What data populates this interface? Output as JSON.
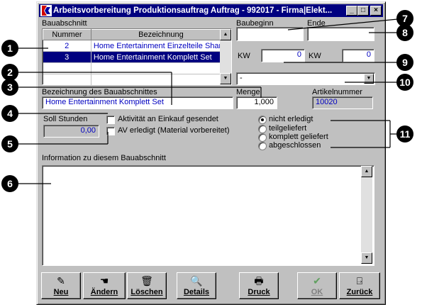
{
  "window": {
    "title": "Arbeitsvorbereitung Produktionsauftrag  Auftrag - 992017 - Firma|Elekt...",
    "controls": {
      "minimize": "_",
      "maximize": "□",
      "close": "×"
    }
  },
  "bauabschnitt": {
    "section_label": "Bauabschnitt",
    "columns": [
      "Nummer",
      "Bezeichnung"
    ],
    "rows": [
      {
        "nummer": "2",
        "bezeichnung": "Home Entertainment Einzelteile Sharp"
      },
      {
        "nummer": "3",
        "bezeichnung": "Home Entertainment Komplett Set"
      }
    ],
    "selected_row": 1
  },
  "schedule": {
    "baubeginn_label": "Baubeginn",
    "baubeginn_value": "",
    "ende_label": "Ende",
    "ende_value": "",
    "kw_label_1": "KW",
    "kw_value_1": "0",
    "kw_label_2": "KW",
    "kw_value_2": "0",
    "dropdown_value": "-"
  },
  "details": {
    "bezeichnung_label": "Bezeichnung des Bauabschnittes",
    "bezeichnung_value": "Home Entertainment Komplett Set",
    "menge_label": "Menge",
    "menge_value": "1,000",
    "artikelnummer_label": "Artikelnummer",
    "artikelnummer_value": "10020",
    "soll_stunden_label": "Soll Stunden",
    "soll_stunden_value": "0,00"
  },
  "checkboxes": [
    {
      "label": "Aktivität an Einkauf gesendet",
      "checked": false
    },
    {
      "label": "AV erledigt (Material vorbereitet)",
      "checked": false
    }
  ],
  "status": {
    "options": [
      "nicht erledigt",
      "teilgeliefert",
      "komplett geliefert",
      "abgeschlossen"
    ],
    "selected": 0
  },
  "info": {
    "label": "Information zu diesem Bauabschnitt",
    "text": ""
  },
  "buttons": [
    {
      "label": "Neu",
      "icon": "pencil-icon",
      "glyph": "✎",
      "enabled": true
    },
    {
      "label": "Ändern",
      "icon": "edit-hand-icon",
      "glyph": "☚",
      "enabled": true
    },
    {
      "label": "Löschen",
      "icon": "trash-icon",
      "glyph": "🗑",
      "enabled": true
    },
    {
      "label": "Details",
      "icon": "magnifier-icon",
      "glyph": "🔍",
      "enabled": true
    },
    {
      "label": "Druck",
      "icon": "printer-icon",
      "glyph": "🖶",
      "enabled": true
    },
    {
      "label": "OK",
      "icon": "checkmark-icon",
      "glyph": "✔",
      "enabled": false
    },
    {
      "label": "Zurück",
      "icon": "exit-door-icon",
      "glyph": "⍈",
      "enabled": true
    }
  ],
  "callouts": [
    "1",
    "2",
    "3",
    "4",
    "5",
    "6",
    "7",
    "8",
    "9",
    "10",
    "11"
  ],
  "colors": {
    "titlebar": "#000080",
    "selection": "#000080",
    "value_text": "#0000c0",
    "face": "#c0c0c0"
  }
}
